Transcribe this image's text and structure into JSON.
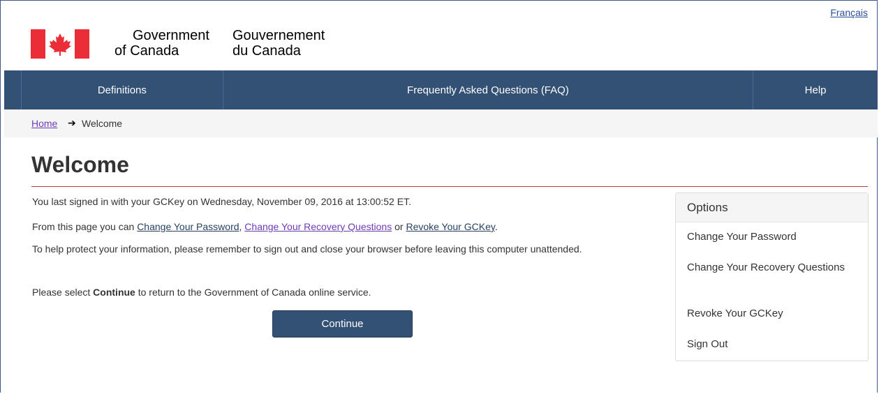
{
  "header": {
    "language_link": "Français",
    "signature_en": [
      "Government",
      "of Canada"
    ],
    "signature_fr": [
      "Gouvernement",
      "du Canada"
    ],
    "flag_color": "#eb2d37"
  },
  "nav": {
    "items": [
      "Definitions",
      "Frequently Asked Questions (FAQ)",
      "Help"
    ]
  },
  "breadcrumb": {
    "home": "Home",
    "separator": "➔",
    "current": "Welcome"
  },
  "main": {
    "title": "Welcome",
    "last_signed_in": "You last signed in with your GCKey on Wednesday, November 09, 2016 at 13:00:52 ET.",
    "from_page_prefix": "From this page you can ",
    "link_change_password": "Change Your Password",
    "comma": ", ",
    "link_change_questions": "Change Your Recovery Questions",
    "or": " or ",
    "link_revoke": "Revoke Your GCKey",
    "period": ".",
    "protect_text": "To help protect your information, please remember to sign out and close your browser before leaving this computer unattended.",
    "select_prefix": "Please select ",
    "select_bold": "Continue",
    "select_suffix": " to return to the Government of Canada online service.",
    "continue_button": "Continue"
  },
  "options": {
    "heading": "Options",
    "items": [
      "Change Your Password",
      "Change Your Recovery Questions",
      "Revoke Your GCKey",
      "Sign Out"
    ]
  },
  "colors": {
    "nav_bg": "#335075",
    "rule": "#af3c43",
    "visited_link": "#6e3bb5"
  }
}
